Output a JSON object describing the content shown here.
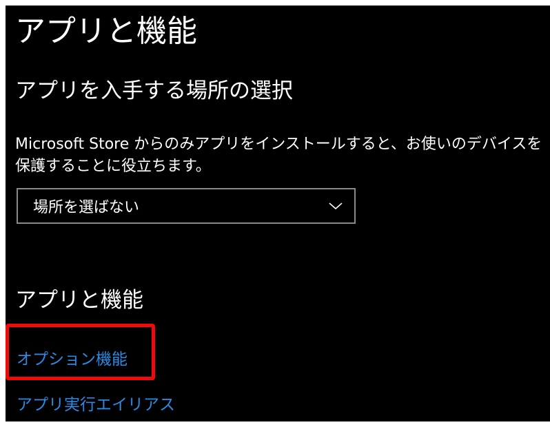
{
  "window": {
    "title": "アプリと機能"
  },
  "install_source": {
    "heading": "アプリを入手する場所の選択",
    "description": "Microsoft Store からのみアプリをインストールすると、お使いのデバイスを保護することに役立ちます。",
    "dropdown": {
      "selected": "場所を選ばない",
      "icon": "chevron-down-icon"
    }
  },
  "apps_features": {
    "heading": "アプリと機能",
    "links": [
      {
        "label": "オプション機能"
      },
      {
        "label": "アプリ実行エイリアス"
      }
    ]
  },
  "annotation": {
    "highlight_color": "#f00a0a",
    "highlighted_item": "オプション機能"
  },
  "theme": {
    "background": "#000000",
    "text": "#ffffff",
    "link": "#2d8ae3",
    "dropdown_border": "#8a8a8a"
  }
}
